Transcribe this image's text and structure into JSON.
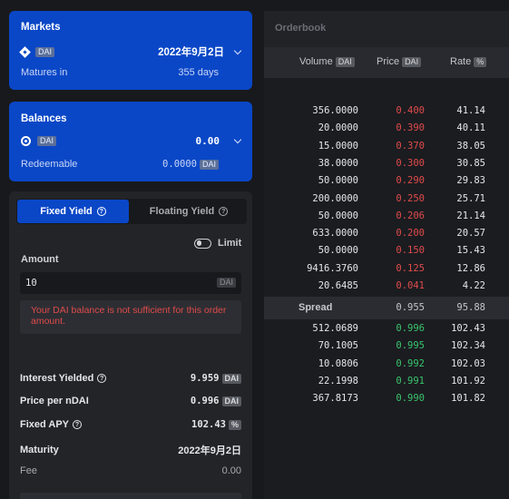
{
  "markets": {
    "title": "Markets",
    "token": "DAI",
    "date": "2022年9月2日",
    "matures_label": "Matures in",
    "matures_value": "355 days"
  },
  "balances": {
    "title": "Balances",
    "token": "DAI",
    "amount": "0.00",
    "redeemable_label": "Redeemable",
    "redeemable_value": "0.0000",
    "redeemable_unit": "DAI"
  },
  "trade": {
    "tab_fixed": "Fixed Yield",
    "tab_floating": "Floating Yield",
    "limit_label": "Limit",
    "amount_label": "Amount",
    "amount_value": "10",
    "amount_unit": "DAI",
    "error": "Your DAI balance is not sufficient for this order amount.",
    "interest_label": "Interest Yielded",
    "interest_value": "9.959",
    "interest_unit": "DAI",
    "price_label": "Price per nDAI",
    "price_value": "0.996",
    "price_unit": "DAI",
    "apy_label": "Fixed APY",
    "apy_value": "102.43",
    "apy_unit": "%",
    "maturity_label": "Maturity",
    "maturity_value": "2022年9月2日",
    "fee_label": "Fee",
    "fee_value": "0.00"
  },
  "orderbook": {
    "title": "Orderbook",
    "col_volume": "Volume",
    "col_volume_unit": "DAI",
    "col_price": "Price",
    "col_price_unit": "DAI",
    "col_rate": "Rate",
    "col_rate_unit": "%",
    "asks": [
      {
        "volume": "356.0000",
        "price": "0.400",
        "rate": "41.14"
      },
      {
        "volume": "20.0000",
        "price": "0.390",
        "rate": "40.11"
      },
      {
        "volume": "15.0000",
        "price": "0.370",
        "rate": "38.05"
      },
      {
        "volume": "38.0000",
        "price": "0.300",
        "rate": "30.85"
      },
      {
        "volume": "50.0000",
        "price": "0.290",
        "rate": "29.83"
      },
      {
        "volume": "200.0000",
        "price": "0.250",
        "rate": "25.71"
      },
      {
        "volume": "50.0000",
        "price": "0.206",
        "rate": "21.14"
      },
      {
        "volume": "633.0000",
        "price": "0.200",
        "rate": "20.57"
      },
      {
        "volume": "50.0000",
        "price": "0.150",
        "rate": "15.43"
      },
      {
        "volume": "9416.3760",
        "price": "0.125",
        "rate": "12.86"
      },
      {
        "volume": "20.6485",
        "price": "0.041",
        "rate": "4.22"
      }
    ],
    "spread": {
      "label": "Spread",
      "price": "0.955",
      "rate": "95.88"
    },
    "bids": [
      {
        "volume": "512.0689",
        "price": "0.996",
        "rate": "102.43"
      },
      {
        "volume": "70.1005",
        "price": "0.995",
        "rate": "102.34"
      },
      {
        "volume": "10.0806",
        "price": "0.992",
        "rate": "102.03"
      },
      {
        "volume": "22.1998",
        "price": "0.991",
        "rate": "101.92"
      },
      {
        "volume": "367.8173",
        "price": "0.990",
        "rate": "101.82"
      }
    ]
  },
  "colors": {
    "accent_blue": "#0a47c7",
    "ask_red": "#e04b4b",
    "bid_green": "#39c46c",
    "error_red": "#e04b4b"
  }
}
